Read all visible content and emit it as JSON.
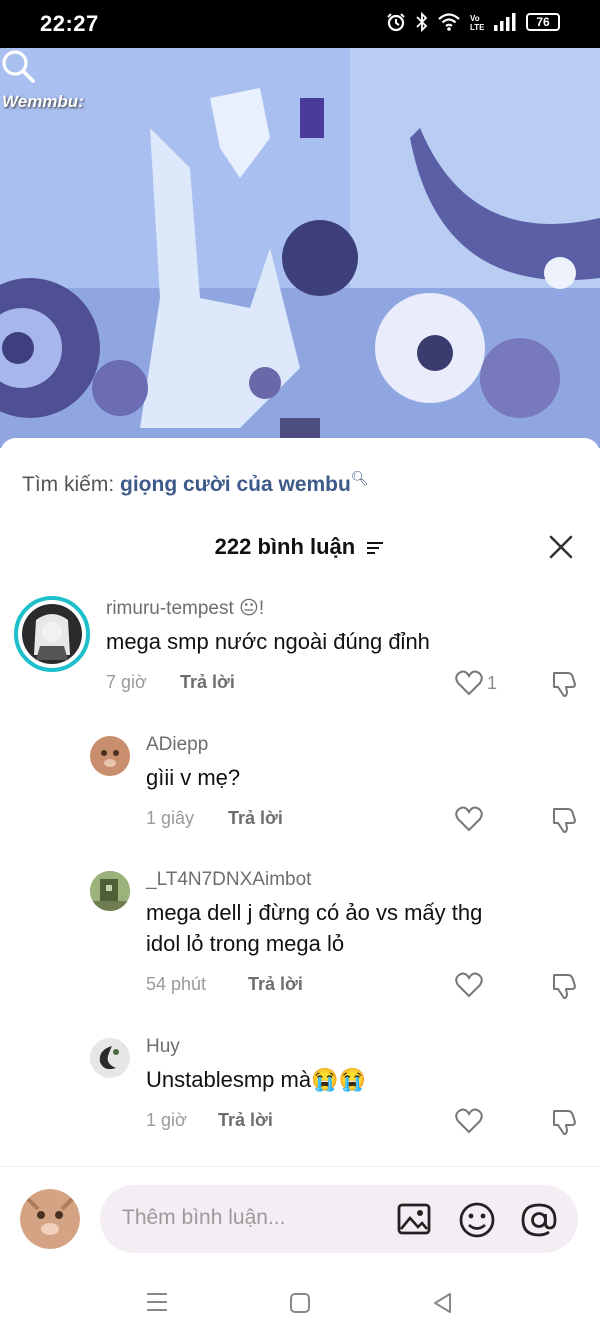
{
  "status": {
    "time": "22:27",
    "battery": "76"
  },
  "video": {
    "overlay_text": "Wemmbu:"
  },
  "search_hint": {
    "label": "Tìm kiếm:",
    "query": "giọng cười của wembu"
  },
  "header": {
    "count_label": "222 bình luận"
  },
  "comments": [
    {
      "username": "rimuru-tempest",
      "username_suffix": "!",
      "lines": [
        "mega smp nước ngoài đúng đỉnh"
      ],
      "time": "7 giờ",
      "reply": "Trả lời",
      "likes": "1"
    },
    {
      "username": "ADiepp",
      "lines": [
        "gìii v mẹ?"
      ],
      "time": "1 giây",
      "reply": "Trả lời",
      "likes": ""
    },
    {
      "username": "_LT4N7DNXAimbot",
      "lines": [
        "mega dell j đừng có ảo vs mấy thg",
        "idol lỏ trong mega lỏ"
      ],
      "time": "54 phút",
      "reply": "Trả lời",
      "likes": ""
    },
    {
      "username": "Huy",
      "lines": [
        "Unstablesmp mà😭😭"
      ],
      "time": "1 giờ",
      "reply": "Trả lời",
      "likes": ""
    }
  ],
  "input": {
    "placeholder": "Thêm bình luận..."
  },
  "colors": {
    "accent": "#3d5a8a",
    "video_bg": "#9fb6e6",
    "input_bg": "#f4eef4"
  },
  "icons": [
    "alarm-icon",
    "bluetooth-icon",
    "wifi-icon",
    "volte-icon",
    "signal-icon",
    "battery-icon",
    "search-icon",
    "sort-icon",
    "close-icon",
    "heart-icon",
    "dislike-icon",
    "image-icon",
    "emoji-icon",
    "mention-icon",
    "menu-icon",
    "home-icon",
    "back-icon"
  ]
}
